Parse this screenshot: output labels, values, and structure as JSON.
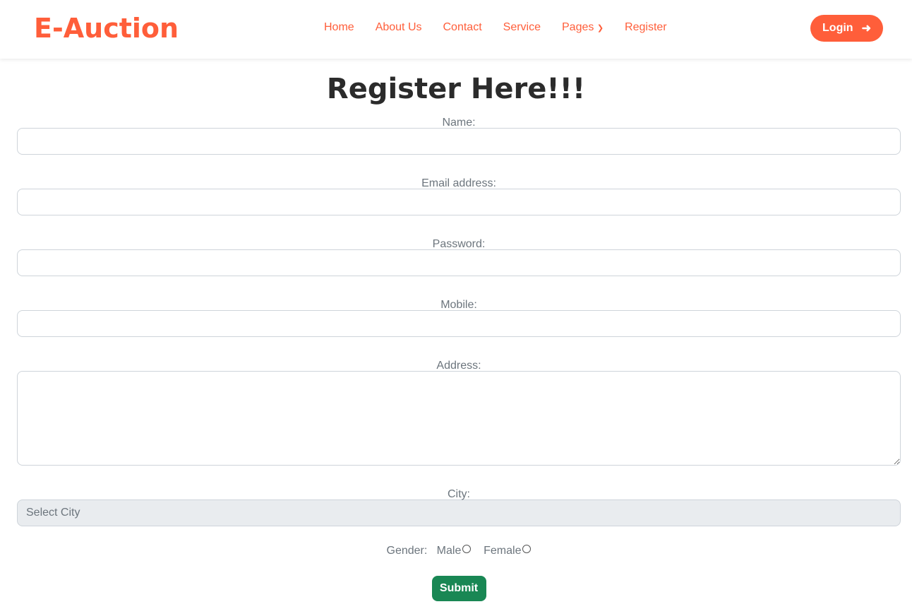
{
  "brand": "E-Auction",
  "nav": {
    "items": [
      "Home",
      "About Us",
      "Contact",
      "Service",
      "Pages",
      "Register"
    ],
    "login": "Login"
  },
  "colors": {
    "accent": "#ff5e3a",
    "submit": "#198754"
  },
  "title": "Register Here!!!",
  "form": {
    "name_label": "Name:",
    "email_label": "Email address:",
    "password_label": "Password:",
    "mobile_label": "Mobile:",
    "address_label": "Address:",
    "city_label": "City:",
    "city_value": "Select City",
    "gender_label": "Gender:",
    "male": "Male",
    "female": "Female",
    "submit": "Submit"
  }
}
